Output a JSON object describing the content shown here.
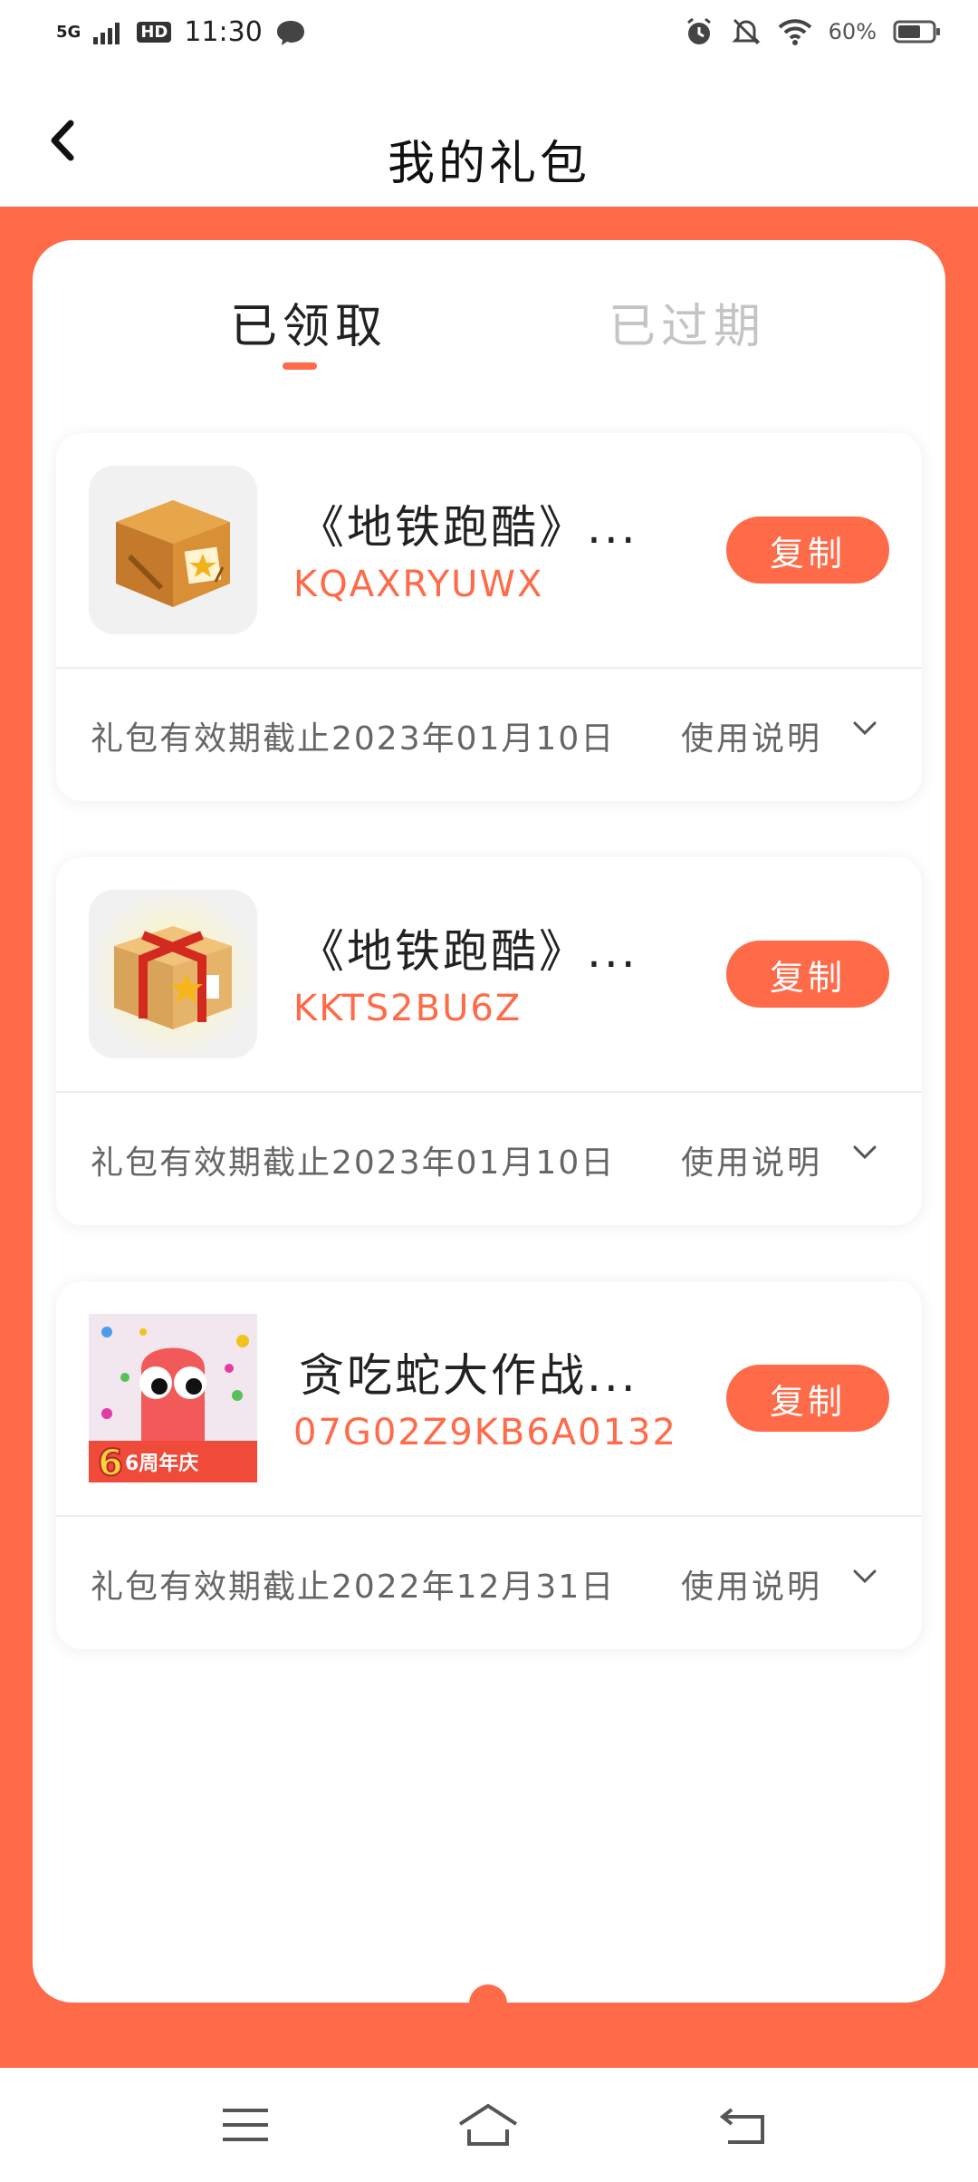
{
  "status_bar": {
    "network": "5G",
    "hd": "HD",
    "time": "11:30",
    "battery": "60%",
    "icons": [
      "signal-icon",
      "chat-bubble-icon",
      "alarm-icon",
      "mute-icon",
      "wifi-icon",
      "battery-icon"
    ]
  },
  "header": {
    "title": "我的礼包",
    "back_icon": "chevron-left-icon"
  },
  "tabs": [
    {
      "label": "已领取",
      "active": true
    },
    {
      "label": "已过期",
      "active": false
    }
  ],
  "cards": [
    {
      "title": "《地铁跑酷》...",
      "code": "KQAXRYUWX",
      "copy_label": "复制",
      "expiry": "礼包有效期截止2023年01月10日",
      "usage_label": "使用说明",
      "icon": "brown-gift-box-icon"
    },
    {
      "title": "《地铁跑酷》...",
      "code": "KKTS2BU6Z",
      "copy_label": "复制",
      "expiry": "礼包有效期截止2023年01月10日",
      "usage_label": "使用说明",
      "icon": "ribbon-gift-box-icon"
    },
    {
      "title": "贪吃蛇大作战...",
      "code": "07G02Z9KB6A0132",
      "copy_label": "复制",
      "expiry": "礼包有效期截止2022年12月31日",
      "usage_label": "使用说明",
      "icon": "snake-game-icon",
      "icon_badge": "6周年庆"
    }
  ],
  "colors": {
    "accent": "#ff6a48",
    "text_primary": "#222222",
    "text_secondary": "#666666",
    "tab_inactive": "#c4c4c4"
  },
  "nav": [
    "menu-icon",
    "home-icon",
    "back-icon"
  ]
}
